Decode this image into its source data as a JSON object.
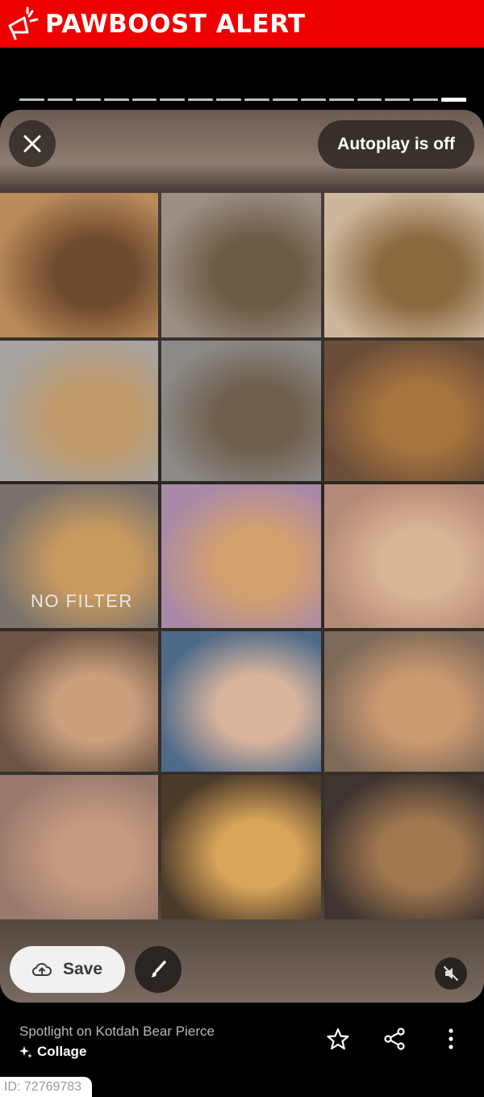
{
  "banner": {
    "title": "PAWBOOST ALERT",
    "logo_icon": "megaphone-icon",
    "color": "#ee0000"
  },
  "progress": {
    "segments_total": 16,
    "active_segment": 16
  },
  "viewer": {
    "autoplay_label": "Autoplay is off",
    "close_icon": "close-icon",
    "save_label": "Save",
    "save_icon": "cloud-upload-icon",
    "edit_icon": "paintbrush-icon",
    "mute_icon": "volume-muted-icon"
  },
  "collage": {
    "cells": [
      {
        "caption": ""
      },
      {
        "caption": ""
      },
      {
        "caption": ""
      },
      {
        "caption": ""
      },
      {
        "caption": ""
      },
      {
        "caption": ""
      },
      {
        "caption": "NO FILTER"
      },
      {
        "caption": ""
      },
      {
        "caption": ""
      },
      {
        "caption": ""
      },
      {
        "caption": ""
      },
      {
        "caption": ""
      },
      {
        "caption": ""
      },
      {
        "caption": ""
      },
      {
        "caption": ""
      }
    ]
  },
  "info": {
    "title": "Spotlight on Kotdah Bear Pierce",
    "subtitle": "Collage",
    "subtitle_icon": "sparkle-icon"
  },
  "actions": {
    "favorite_icon": "star-icon",
    "share_icon": "share-icon",
    "more_icon": "more-vert-icon"
  },
  "footer": {
    "id_label": "ID: 72769783"
  }
}
